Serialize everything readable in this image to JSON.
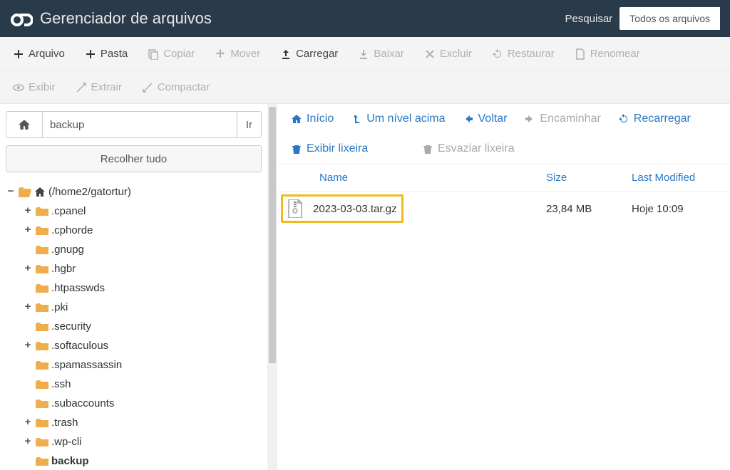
{
  "header": {
    "title": "Gerenciador de arquivos",
    "search_label": "Pesquisar",
    "search_scope": "Todos os arquivos"
  },
  "toolbar": {
    "file": "Arquivo",
    "folder": "Pasta",
    "copy": "Copiar",
    "move": "Mover",
    "upload": "Carregar",
    "download": "Baixar",
    "delete": "Excluir",
    "restore": "Restaurar",
    "rename": "Renomear",
    "view": "Exibir",
    "extract": "Extrair",
    "compress": "Compactar"
  },
  "left": {
    "path_value": "backup",
    "go_label": "Ir",
    "collapse_label": "Recolher tudo",
    "root_label": "(/home2/gatortur)",
    "items": [
      {
        "label": ".cpanel",
        "exp": "+"
      },
      {
        "label": ".cphorde",
        "exp": "+"
      },
      {
        "label": ".gnupg",
        "exp": ""
      },
      {
        "label": ".hgbr",
        "exp": "+"
      },
      {
        "label": ".htpasswds",
        "exp": ""
      },
      {
        "label": ".pki",
        "exp": "+"
      },
      {
        "label": ".security",
        "exp": ""
      },
      {
        "label": ".softaculous",
        "exp": "+"
      },
      {
        "label": ".spamassassin",
        "exp": ""
      },
      {
        "label": ".ssh",
        "exp": ""
      },
      {
        "label": ".subaccounts",
        "exp": ""
      },
      {
        "label": ".trash",
        "exp": "+"
      },
      {
        "label": ".wp-cli",
        "exp": "+"
      },
      {
        "label": "backup",
        "exp": "",
        "bold": true
      }
    ]
  },
  "right_actions": {
    "home": "Início",
    "up": "Um nível acima",
    "back": "Voltar",
    "forward": "Encaminhar",
    "reload": "Recarregar",
    "show_trash": "Exibir lixeira",
    "empty_trash": "Esvaziar lixeira"
  },
  "table": {
    "cols": {
      "name": "Name",
      "size": "Size",
      "modified": "Last Modified"
    },
    "rows": [
      {
        "name": "2023-03-03.tar.gz",
        "size": "23,84 MB",
        "modified": "Hoje 10:09"
      }
    ]
  }
}
